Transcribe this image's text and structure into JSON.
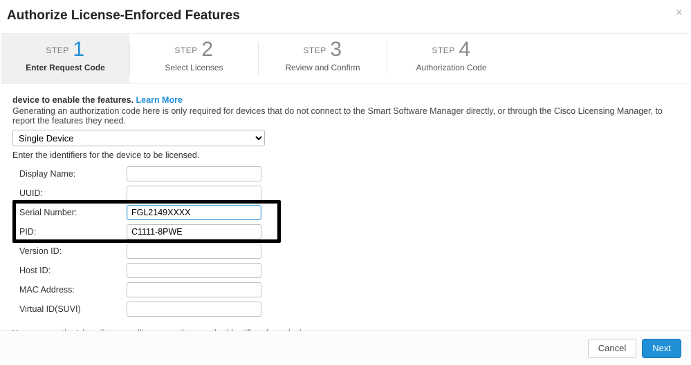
{
  "dialog": {
    "title": "Authorize License-Enforced Features"
  },
  "stepper": {
    "label": "STEP",
    "steps": [
      {
        "num": "1",
        "label": "Enter Request Code"
      },
      {
        "num": "2",
        "label": "Select Licenses"
      },
      {
        "num": "3",
        "label": "Review and Confirm"
      },
      {
        "num": "4",
        "label": "Authorization Code"
      }
    ]
  },
  "lead": {
    "prefix": "device to enable the features.",
    "learn_more": "Learn More",
    "desc": "Generating an authorization code here is only required for devices that do not connect to the Smart Software Manager directly, or through the Cisco Licensing Manager, to report the features they need."
  },
  "device_select": {
    "value": "Single Device"
  },
  "identifiers": {
    "instr": "Enter the identifiers for the device to be licensed.",
    "fields": {
      "display_name": {
        "label": "Display Name:",
        "value": ""
      },
      "uuid": {
        "label": "UUID:",
        "value": ""
      },
      "serial": {
        "label": "Serial Number:",
        "value": "FGL2149XXXX"
      },
      "pid": {
        "label": "PID:",
        "value": "C1111-8PWE"
      },
      "version_id": {
        "label": "Version ID:",
        "value": ""
      },
      "host_id": {
        "label": "Host ID:",
        "value": ""
      },
      "mac": {
        "label": "MAC Address:",
        "value": ""
      },
      "suvi": {
        "label": "Virtual ID(SUVI)",
        "value": ""
      }
    },
    "hint": "You can use the 'show license udi' command to see the identifiers for a device"
  },
  "footer": {
    "cancel": "Cancel",
    "next": "Next"
  }
}
